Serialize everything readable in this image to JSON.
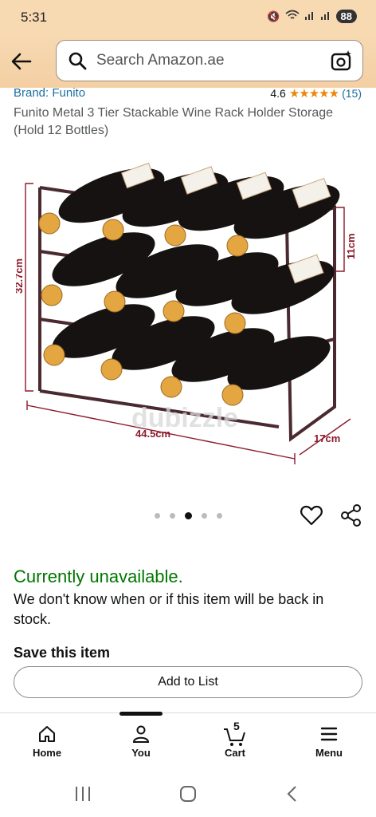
{
  "status_bar": {
    "time": "5:31",
    "battery": "88"
  },
  "search": {
    "placeholder": "Search Amazon.ae"
  },
  "product": {
    "brand": "Brand: Funito",
    "rating": "4.6",
    "stars": "★★★★★",
    "review_count": "(15)",
    "title": "Funito Metal 3 Tier Stackable Wine Rack Holder Storage (Hold 12 Bottles)"
  },
  "image": {
    "dim_height": "32.7cm",
    "dim_width": "44.5cm",
    "dim_depth": "17cm",
    "dim_tier": "11cm",
    "watermark": "dubizzle"
  },
  "carousel": {
    "total": 5,
    "active_index": 2
  },
  "availability": {
    "status": "Currently unavailable.",
    "note": "We don't know when or if this item will be back in stock."
  },
  "save": {
    "title": "Save this item",
    "add_to_list": "Add to List"
  },
  "nav": {
    "home": "Home",
    "you": "You",
    "cart": "Cart",
    "cart_count": "5",
    "menu": "Menu"
  },
  "colors": {
    "link": "#1a6fa0",
    "star": "#e8890c",
    "available_green": "#007600",
    "header": "#f7d9b2"
  }
}
